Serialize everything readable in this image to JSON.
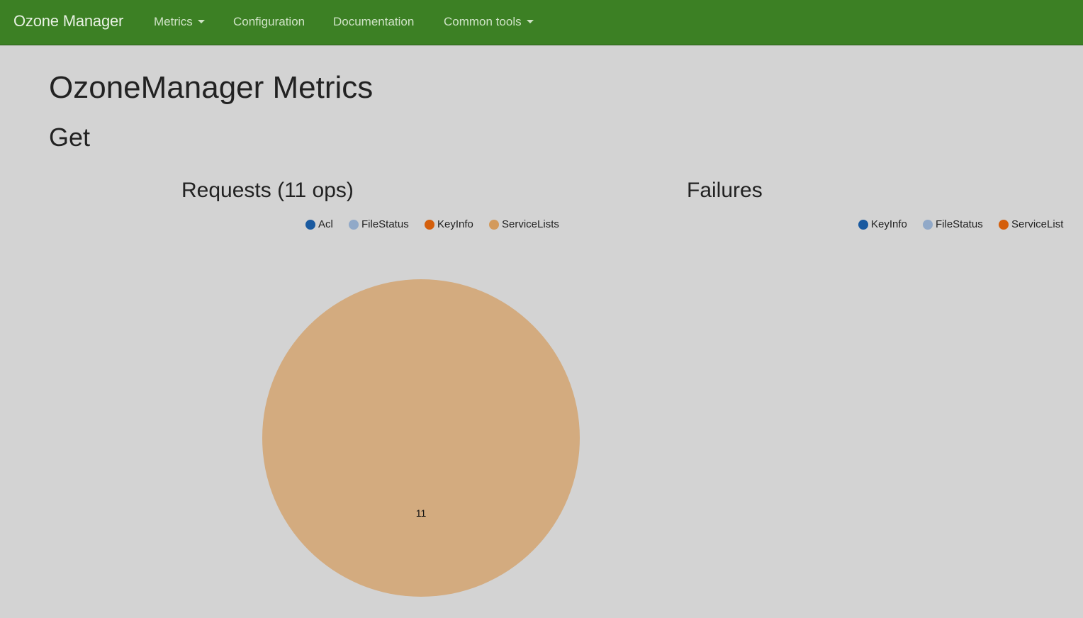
{
  "navbar": {
    "brand": "Ozone Manager",
    "items": [
      {
        "label": "Metrics",
        "dropdown": true
      },
      {
        "label": "Configuration",
        "dropdown": false
      },
      {
        "label": "Documentation",
        "dropdown": false
      },
      {
        "label": "Common tools",
        "dropdown": true
      }
    ],
    "colors": {
      "background": "#3c8024",
      "text": "#cfe3c6"
    }
  },
  "page": {
    "title": "OzoneManager Metrics",
    "section": "Get"
  },
  "requests": {
    "title": "Requests (11 ops)",
    "legend": [
      {
        "label": "Acl",
        "color": "#1a5aa0"
      },
      {
        "label": "FileStatus",
        "color": "#91a9c8"
      },
      {
        "label": "KeyInfo",
        "color": "#d45f0c"
      },
      {
        "label": "ServiceLists",
        "color": "#d39a5c"
      }
    ]
  },
  "failures": {
    "title": "Failures",
    "legend": [
      {
        "label": "KeyInfo",
        "color": "#1a5aa0"
      },
      {
        "label": "FileStatus",
        "color": "#91a9c8"
      },
      {
        "label": "ServiceList",
        "color": "#d45f0c"
      }
    ]
  },
  "chart_data": [
    {
      "type": "pie",
      "title": "Requests (11 ops)",
      "categories": [
        "Acl",
        "FileStatus",
        "KeyInfo",
        "ServiceLists"
      ],
      "values": [
        0,
        0,
        0,
        11
      ],
      "colors": [
        "#1a5aa0",
        "#91a9c8",
        "#d45f0c",
        "#d39a5c"
      ],
      "slice_fill": "#d3ab7f",
      "data_labels": [
        "11"
      ],
      "legend": "top"
    },
    {
      "type": "pie",
      "title": "Failures",
      "categories": [
        "KeyInfo",
        "FileStatus",
        "ServiceList"
      ],
      "values": [
        0,
        0,
        0
      ],
      "colors": [
        "#1a5aa0",
        "#91a9c8",
        "#d45f0c"
      ],
      "legend": "top-right"
    }
  ]
}
